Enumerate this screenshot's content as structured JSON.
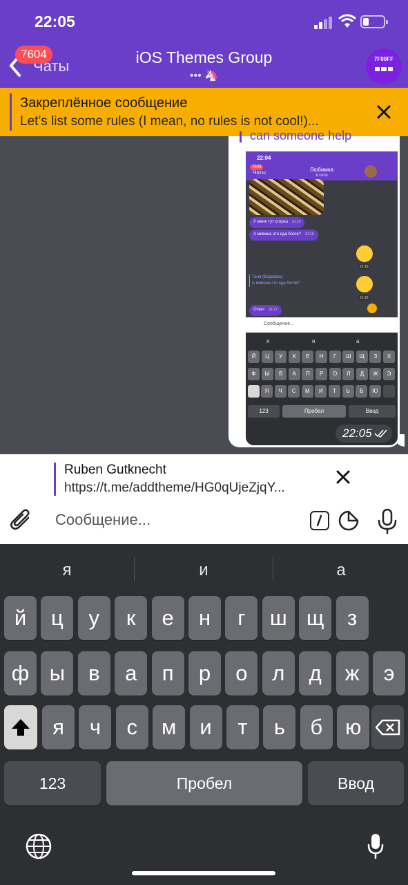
{
  "status_bar": {
    "time": "22:05"
  },
  "header": {
    "back_label": "Чаты",
    "unread_badge": "7604",
    "title": "iOS Themes Group",
    "subtitle": "••• 🦄",
    "avatar_text": "7F00FF"
  },
  "pinned": {
    "title": "Закреплённое сообщение",
    "text": "Let’s list some rules (I mean, no rules is not cool!)..."
  },
  "message": {
    "reply_snippet": "can someone help",
    "time": "22:05",
    "screenshot": {
      "time": "22:04",
      "badge": "7603",
      "back": "Чаты",
      "name": "Любимка",
      "status": "в сети",
      "msgs": [
        {
          "text": "У меня тут стирка",
          "time": "21:15"
        },
        {
          "text": "А мивина это еда богов?",
          "time": "21:16"
        }
      ],
      "emoji_times": [
        "21:16",
        "21:16"
      ],
      "quote_name": "Таня (Водафон)",
      "quote_text": "А мивина это еда богов?",
      "answer": {
        "text": "Ответ",
        "time": "21:17"
      },
      "input_placeholder": "Сообщение...",
      "suggestions": [
        "я",
        "и",
        "а"
      ],
      "kb_row1": [
        "Й",
        "Ц",
        "У",
        "К",
        "Е",
        "Н",
        "Г",
        "Ш",
        "Щ",
        "З",
        "Х"
      ],
      "kb_row2": [
        "Ф",
        "Ы",
        "В",
        "А",
        "П",
        "Р",
        "О",
        "Л",
        "Д",
        "Ж",
        "Э"
      ],
      "kb_row3": [
        "Я",
        "Ч",
        "С",
        "М",
        "И",
        "Т",
        "Ь",
        "Б",
        "Ю"
      ],
      "kb_123": "123",
      "kb_space": "Пробел",
      "kb_enter": "Ввод"
    }
  },
  "reply_preview": {
    "name": "Ruben Gutknecht",
    "link": "https://t.me/addtheme/HG0qUjeZjqY..."
  },
  "composer": {
    "placeholder": "Сообщение..."
  },
  "keyboard": {
    "suggestions": [
      "я",
      "и",
      "а"
    ],
    "row1": [
      "й",
      "ц",
      "у",
      "к",
      "е",
      "н",
      "г",
      "ш",
      "щ",
      "з"
    ],
    "row2": [
      "ф",
      "ы",
      "в",
      "а",
      "п",
      "р",
      "о",
      "л",
      "д",
      "ж",
      "э"
    ],
    "row3": [
      "я",
      "ч",
      "с",
      "м",
      "и",
      "т",
      "ь",
      "б",
      "ю"
    ],
    "key_123": "123",
    "key_space": "Пробел",
    "key_enter": "Ввод"
  },
  "colors": {
    "accent": "#6a3ec8",
    "pinned_bg": "#f8ae00",
    "badge": "#ff4d55"
  }
}
